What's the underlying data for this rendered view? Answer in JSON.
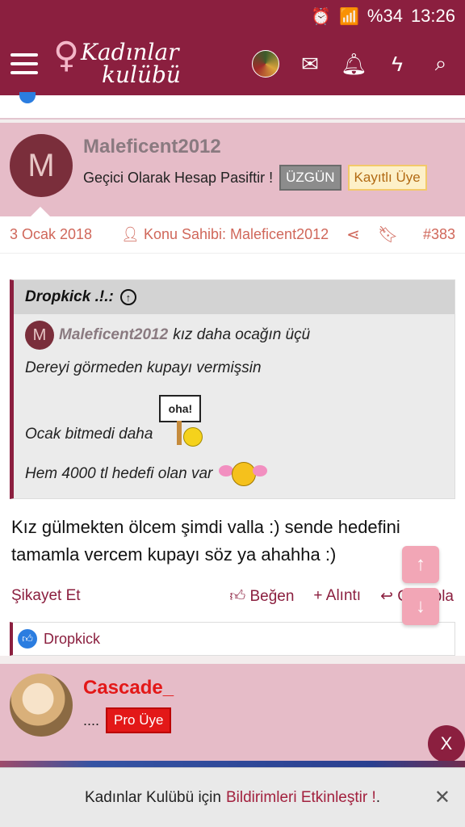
{
  "status": {
    "battery": "%34",
    "time": "13:26"
  },
  "header": {
    "logo_line1": "Kadınlar",
    "logo_line2": "kulübü"
  },
  "post1": {
    "author": "Maleficent2012",
    "avatar_letter": "M",
    "user_title": "Geçici Olarak Hesap Pasiftir !",
    "badge1": "ÜZGÜN",
    "badge2": "Kayıtlı Üye",
    "date": "3 Ocak 2018",
    "owner_label": "Konu Sahibi: Maleficent2012",
    "post_number": "#383",
    "quote": {
      "quoted_author": "Dropkick .!.:",
      "inner_author": "Maleficent2012",
      "inner_text": "kız daha ocağın üçü",
      "inner_avatar_letter": "M",
      "line1": "Dereyi görmeden kupayı vermişsin",
      "line2": "Ocak bitmedi daha",
      "sign_text": "oha!",
      "line3": "Hem 4000 tl hedefi olan var"
    },
    "message": "Kız gülmekten ölcem şimdi valla :) sende hedefini tamamla vercem kupayı söz ya ahahha :)",
    "actions": {
      "report": "Şikayet Et",
      "like": "Beğen",
      "quote": "Alıntı",
      "reply": "Cevapla"
    },
    "reaction_user": "Dropkick"
  },
  "post2": {
    "author": "Cascade_",
    "dots": "....",
    "badge": "Pro Üye"
  },
  "close_label": "X",
  "notification": {
    "text": "Kadınlar Kulübü için",
    "link": "Bildirimleri Etkinleştir !",
    "after": "."
  },
  "colors": {
    "brand": "#8b1f3f",
    "header_pink": "#e6bcc8",
    "accent_red": "#d0675a"
  }
}
